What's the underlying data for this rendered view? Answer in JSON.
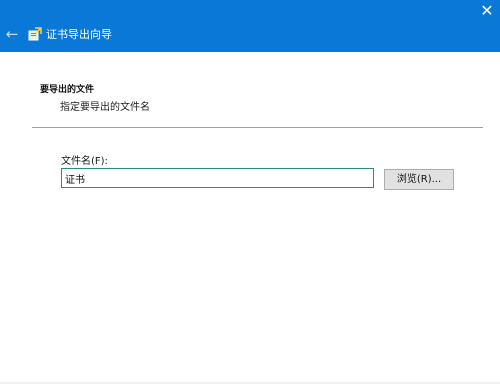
{
  "window": {
    "title": "证书导出向导"
  },
  "header": {
    "title": "要导出的文件",
    "subtitle": "指定要导出的文件名"
  },
  "form": {
    "filename_label": "文件名(F):",
    "filename_value": "证书",
    "browse_label": "浏览(R)..."
  },
  "icons": {
    "back": "back-arrow-icon",
    "close": "close-icon",
    "wizard": "certificate-export-icon"
  },
  "colors": {
    "titlebar": "#0a78d7",
    "input_border": "#2f8a7a",
    "button_bg": "#e1e1e1"
  }
}
